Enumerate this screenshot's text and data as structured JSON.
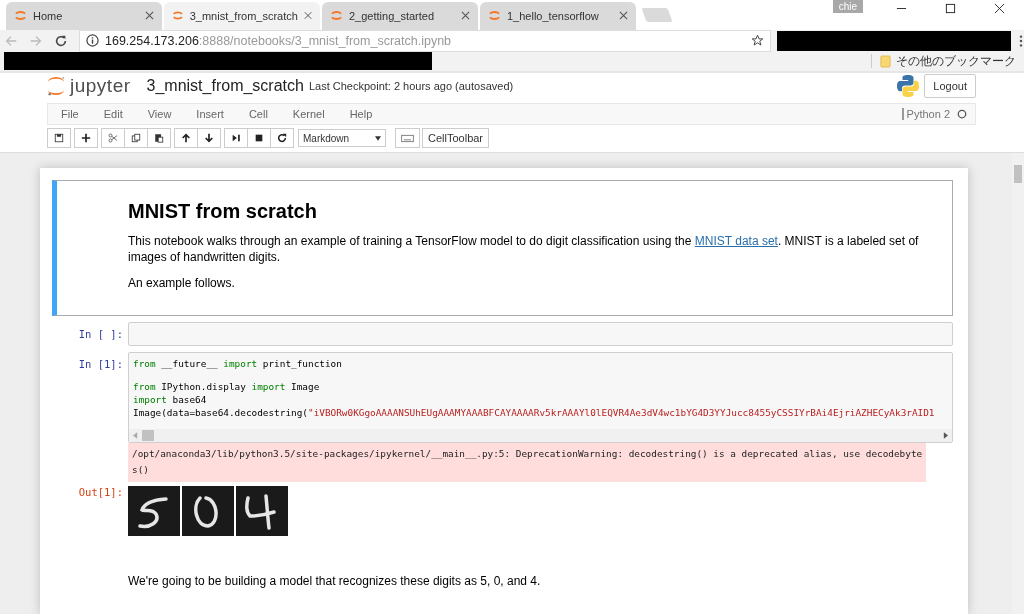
{
  "browser": {
    "tabs": [
      {
        "label": "Home",
        "selected": false
      },
      {
        "label": "3_mnist_from_scratch",
        "selected": true
      },
      {
        "label": "2_getting_started",
        "selected": false
      },
      {
        "label": "1_hello_tensorflow",
        "selected": false
      }
    ],
    "user_badge": "chie",
    "address": {
      "host": "169.254.173.206",
      "rest": ":8888/notebooks/3_mnist_from_scratch.ipynb"
    },
    "bookmarks_folder": "その他のブックマーク"
  },
  "jupyter": {
    "logo_text": "jupyter",
    "notebook_name": "3_mnist_from_scratch",
    "checkpoint": "Last Checkpoint: 2 hours ago (autosaved)",
    "logout": "Logout",
    "menu": [
      "File",
      "Edit",
      "View",
      "Insert",
      "Cell",
      "Kernel",
      "Help"
    ],
    "kernel": "Python 2",
    "cell_type": "Markdown",
    "celltoolbar": "CellToolbar"
  },
  "cells": [
    {
      "kind": "markdown",
      "selected": true,
      "heading": "MNIST from scratch",
      "paragraphs": [
        {
          "before": "This notebook walks through an example of training a TensorFlow model to do digit classification using the ",
          "link": "MNIST data set",
          "after": ". MNIST is a labeled set of images of handwritten digits."
        },
        {
          "before": "An example follows."
        }
      ]
    },
    {
      "kind": "code",
      "selected": false,
      "prompt": "In [ ]:"
    },
    {
      "kind": "code",
      "selected": false,
      "prompt": "In [1]:",
      "blocks": [
        [
          [
            {
              "kind": "keyword",
              "text": "from"
            },
            {
              "kind": "plain",
              "text": " __future__ "
            },
            {
              "kind": "keyword",
              "text": "import"
            },
            {
              "kind": "plain",
              "text": " print_function"
            }
          ]
        ],
        [
          [
            {
              "kind": "keyword",
              "text": "from"
            },
            {
              "kind": "plain",
              "text": " IPython.display "
            },
            {
              "kind": "keyword",
              "text": "import"
            },
            {
              "kind": "plain",
              "text": " Image"
            }
          ],
          [
            {
              "kind": "keyword",
              "text": "import"
            },
            {
              "kind": "plain",
              "text": " base64"
            }
          ],
          [
            {
              "kind": "plain",
              "text": "Image(data=base64.decodestring("
            },
            {
              "kind": "string",
              "text": "\"iVBORw0KGgoAAAANSUhEUgAAAMYAAABFCAYAAAARv5krAAAYl0lEQVR4Ae3dV4wc1bYG4D3YYJucc8455yCSSIYrBAi4EjriAZHECyAk3rAID1"
            }
          ]
        ]
      ],
      "stderr": "/opt/anaconda3/lib/python3.5/site-packages/ipykernel/__main__.py:5: DeprecationWarning: decodestring() is a deprecated alias, use decodebytes()",
      "out_prompt": "Out[1]:",
      "out": {
        "kind": "picture"
      }
    },
    {
      "kind": "markdown",
      "selected": false,
      "paragraphs": [
        {
          "before": "We're going to be building a model that recognizes these digits as 5, 0, and 4."
        }
      ]
    }
  ]
}
